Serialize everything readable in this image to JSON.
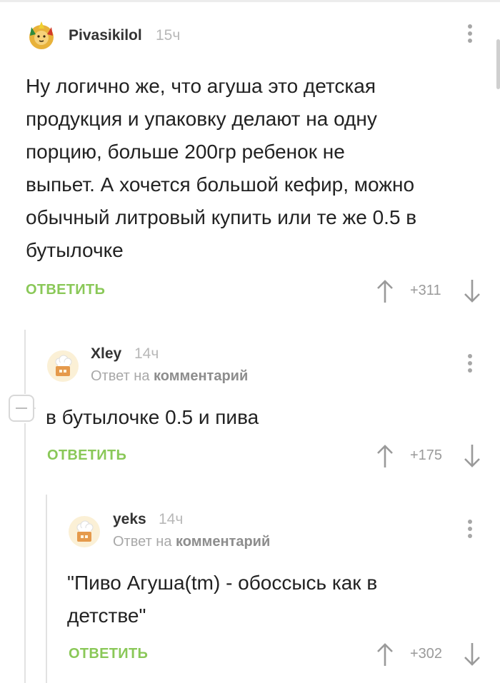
{
  "comments": [
    {
      "author": "Pivasikilol",
      "time": "15ч",
      "text_lines": [
        "Ну логично же, что агуша это детская",
        "продукция и упаковку делают на одну",
        "порцию, больше 200гр ребенок не",
        "выпьет. А хочется большой кефир, можно",
        "обычный литровый купить или те же 0.5 в",
        "бутылочке"
      ],
      "reply_label": "ОТВЕТИТЬ",
      "score": "+311"
    },
    {
      "author": "Xley",
      "time": "14ч",
      "reply_prefix": "Ответ на",
      "reply_target": "комментарий",
      "text_lines": [
        "в бутылочке 0.5 и пива"
      ],
      "reply_label": "ОТВЕТИТЬ",
      "score": "+175"
    },
    {
      "author": "yeks",
      "time": "14ч",
      "reply_prefix": "Ответ на",
      "reply_target": "комментарий",
      "text_lines": [
        "\"Пиво Агуша(tm) - обоссысь как в",
        "детстве\""
      ],
      "reply_label": "ОТВЕТИТЬ",
      "score": "+302"
    }
  ],
  "colors": {
    "accent": "#8ac858",
    "muted": "#a7a7a7",
    "text": "#222222"
  },
  "icons": [
    "lion-avatar-icon",
    "chef-hat-avatar-icon",
    "more-vertical-icon",
    "arrow-up-icon",
    "arrow-down-icon",
    "collapse-minus-icon"
  ]
}
